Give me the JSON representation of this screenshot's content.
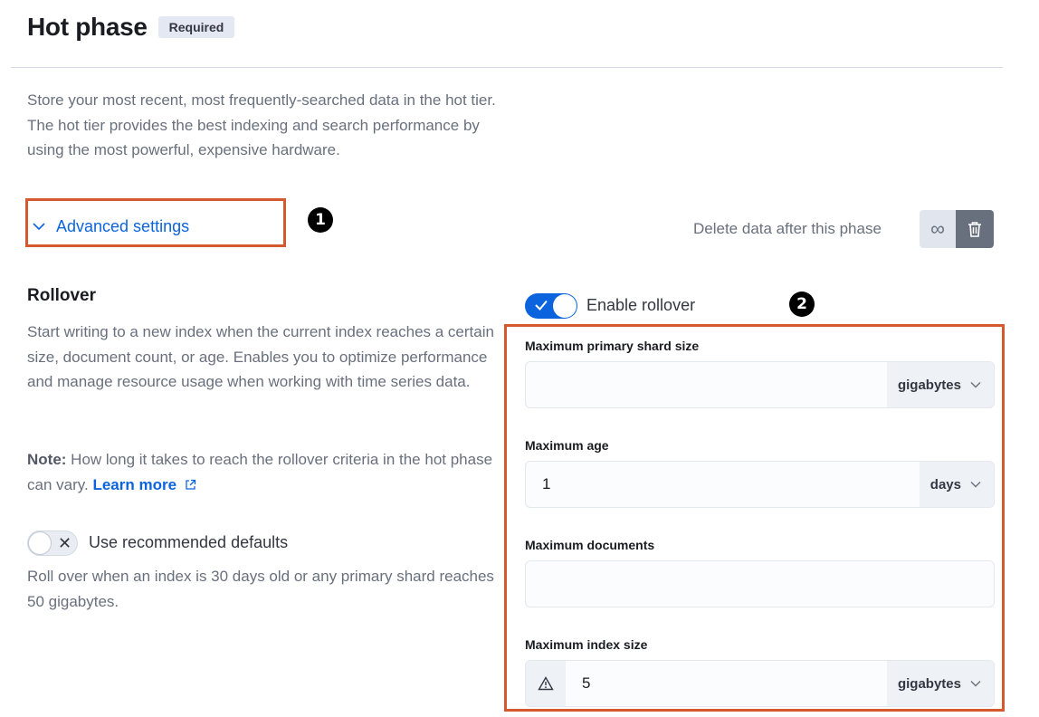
{
  "header": {
    "title": "Hot phase",
    "badge": "Required"
  },
  "description": "Store your most recent, most frequently-searched data in the hot tier. The hot tier provides the best indexing and search performance by using the most powerful, expensive hardware.",
  "advanced_settings": {
    "label": "Advanced settings"
  },
  "callouts": {
    "one": "1",
    "two": "2"
  },
  "delete_phase": {
    "label": "Delete data after this phase",
    "infinity_icon": "∞"
  },
  "rollover": {
    "title": "Rollover",
    "description": "Start writing to a new index when the current index reaches a certain size, document count, or age. Enables you to optimize performance and manage resource usage when working with time series data.",
    "note_prefix": "Note:",
    "note_text": " How long it takes to reach the rollover criteria in the hot phase can vary. ",
    "learn_more": "Learn more",
    "use_defaults": {
      "label": "Use recommended defaults",
      "enabled": false,
      "description": "Roll over when an index is 30 days old or any primary shard reaches 50 gigabytes."
    },
    "enable_rollover": {
      "label": "Enable rollover",
      "enabled": true
    }
  },
  "fields": {
    "max_primary_shard_size": {
      "label": "Maximum primary shard size",
      "value": "",
      "unit": "gigabytes"
    },
    "max_age": {
      "label": "Maximum age",
      "value": "1",
      "unit": "days"
    },
    "max_documents": {
      "label": "Maximum documents",
      "value": ""
    },
    "max_index_size": {
      "label": "Maximum index size",
      "value": "5",
      "unit": "gigabytes"
    }
  },
  "colors": {
    "accent": "#0b64dd",
    "highlight_border": "#d4592f",
    "muted_text": "#69707d"
  }
}
